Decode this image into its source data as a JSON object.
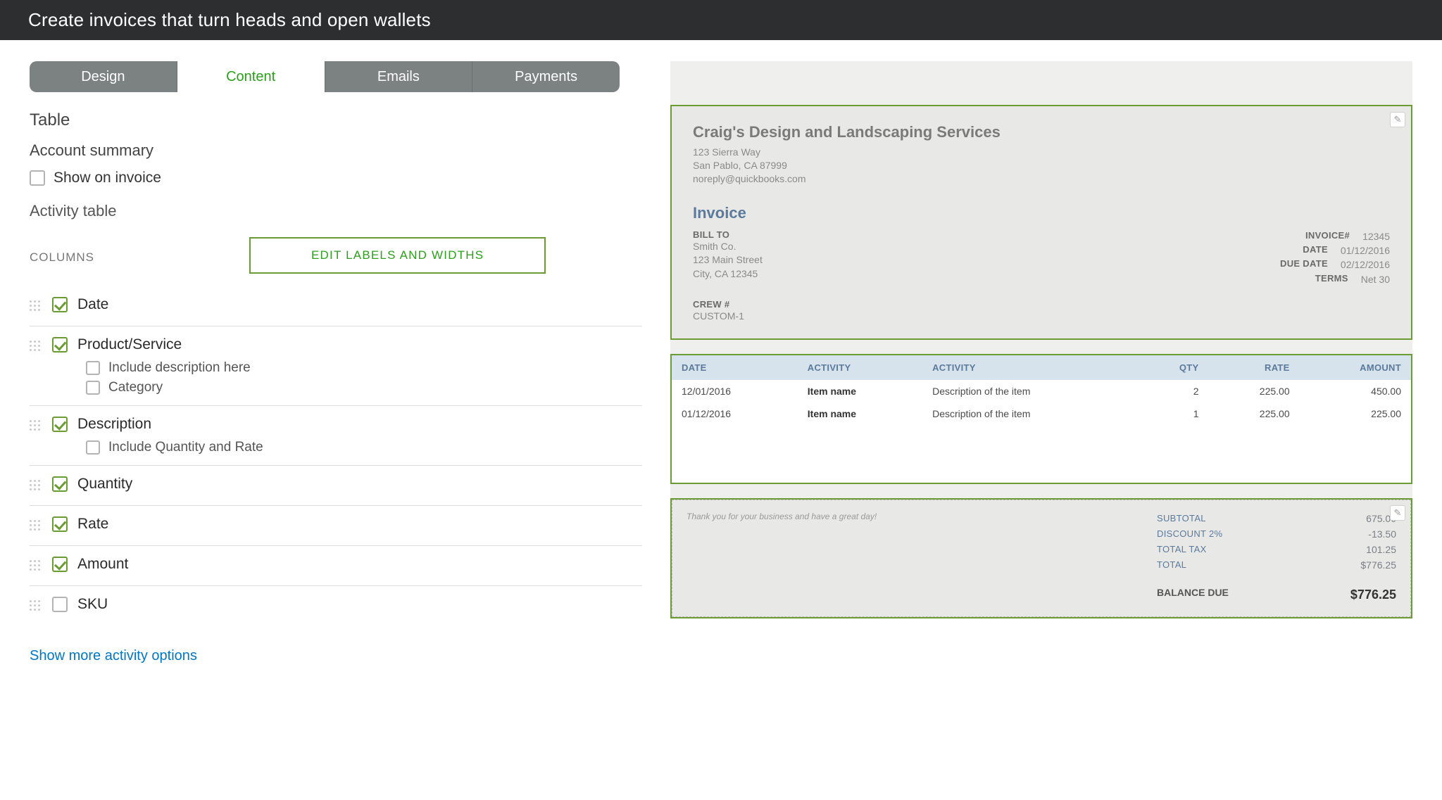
{
  "titleBar": {
    "title": "Create invoices that turn heads and open wallets"
  },
  "tabs": [
    "Design",
    "Content",
    "Emails",
    "Payments"
  ],
  "activeTab": 1,
  "sections": {
    "table_header": "Table",
    "account_summary": "Account summary",
    "show_on_invoice": "Show on invoice",
    "activity_table": "Activity table",
    "columns_label": "COLUMNS",
    "edit_labels_btn": "EDIT LABELS AND WIDTHS",
    "more_link": "Show more activity options"
  },
  "columns": [
    {
      "name": "Date",
      "checked": true,
      "subs": []
    },
    {
      "name": "Product/Service",
      "checked": true,
      "subs": [
        {
          "name": "Include description here",
          "checked": false
        },
        {
          "name": "Category",
          "checked": false
        }
      ]
    },
    {
      "name": "Description",
      "checked": true,
      "subs": [
        {
          "name": "Include Quantity and Rate",
          "checked": false
        }
      ]
    },
    {
      "name": "Quantity",
      "checked": true,
      "subs": []
    },
    {
      "name": "Rate",
      "checked": true,
      "subs": []
    },
    {
      "name": "Amount",
      "checked": true,
      "subs": []
    },
    {
      "name": "SKU",
      "checked": false,
      "subs": []
    }
  ],
  "preview": {
    "company": "Craig's Design and Landscaping Services",
    "address_line1": "123 Sierra Way",
    "address_line2": "San Pablo, CA 87999",
    "email": "noreply@quickbooks.com",
    "doc_title": "Invoice",
    "billto_label": "BILL TO",
    "billto_name": "Smith Co.",
    "billto_addr1": "123 Main Street",
    "billto_addr2": "City, CA 12345",
    "meta": [
      {
        "label": "INVOICE#",
        "value": "12345"
      },
      {
        "label": "DATE",
        "value": "01/12/2016"
      },
      {
        "label": "DUE DATE",
        "value": "02/12/2016"
      },
      {
        "label": "TERMS",
        "value": "Net 30"
      }
    ],
    "crew_label": "CREW #",
    "crew_value": "CUSTOM-1",
    "table_headers": [
      "DATE",
      "ACTIVITY",
      "ACTIVITY",
      "QTY",
      "RATE",
      "AMOUNT"
    ],
    "rows": [
      {
        "date": "12/01/2016",
        "item": "Item name",
        "desc": "Description of the item",
        "qty": "2",
        "rate": "225.00",
        "amount": "450.00"
      },
      {
        "date": "01/12/2016",
        "item": "Item name",
        "desc": "Description of the item",
        "qty": "1",
        "rate": "225.00",
        "amount": "225.00"
      }
    ],
    "thanks": "Thank you for your business and have a great day!",
    "totals": [
      {
        "label": "SUBTOTAL",
        "value": "675.00"
      },
      {
        "label": "DISCOUNT 2%",
        "value": "-13.50"
      },
      {
        "label": "TOTAL TAX",
        "value": "101.25"
      },
      {
        "label": "TOTAL",
        "value": "$776.25"
      }
    ],
    "balance_label": "BALANCE DUE",
    "balance_value": "$776.25"
  }
}
